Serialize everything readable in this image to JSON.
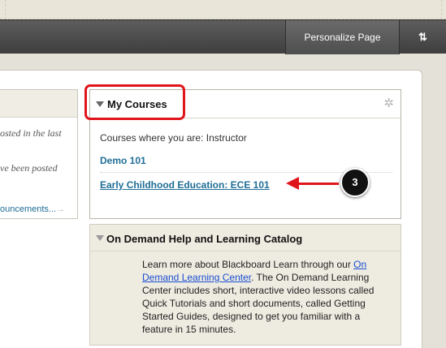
{
  "toolbar": {
    "personalize_label": "Personalize Page",
    "reorder_icon": "sort-arrows-icon",
    "reorder_glyph": "⇅"
  },
  "left_module": {
    "line1": "osted in the last",
    "line2": "ve been posted",
    "more_link": "ouncements...",
    "more_arrow": "→"
  },
  "my_courses": {
    "title": "My Courses",
    "intro": "Courses where you are: Instructor",
    "courses": [
      {
        "label": "Demo 101"
      },
      {
        "label": "Early Childhood Education: ECE 101"
      }
    ],
    "gear_glyph": "✲"
  },
  "callout": {
    "number": "3",
    "accent_color": "#e0151b"
  },
  "on_demand": {
    "title": "On Demand Help and Learning Catalog",
    "text_before": "Learn more about Blackboard Learn through our ",
    "link": "On Demand Learning Center",
    "text_after": ". The On Demand Learning Center includes short, interactive video lessons called Quick Tutorials and short documents, called Getting Started Guides, designed to get you familiar with a feature in 15 minutes."
  }
}
